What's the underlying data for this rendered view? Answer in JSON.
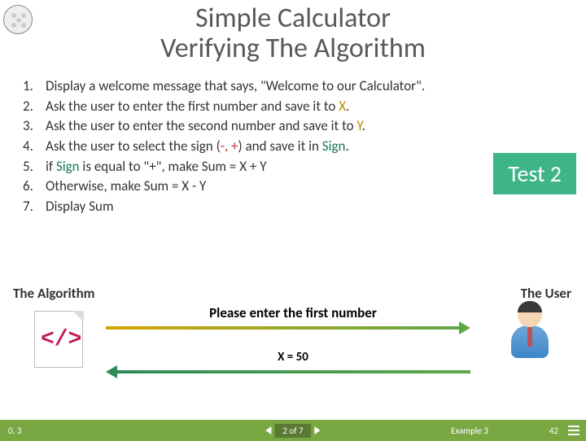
{
  "title": "Simple Calculator",
  "subtitle": "Verifying The Algorithm",
  "steps": [
    {
      "num": "1.",
      "text": "Display a welcome message that says, \"Welcome to our Calculator\"."
    },
    {
      "num": "2.",
      "text": "Ask the user to enter the first number and save it to ",
      "var": "X",
      "varClass": "hl-orange",
      "suffix": "."
    },
    {
      "num": "3.",
      "text": "Ask the user to enter the second number and save it to ",
      "var": "Y",
      "varClass": "hl-orange",
      "suffix": "."
    },
    {
      "num": "4.",
      "text": "Ask the user to select the sign (",
      "mid": "-, +",
      "midClass": "hl-red",
      "text2": ") and save it in ",
      "var": "Sign",
      "varClass": "hl-green",
      "suffix": "."
    },
    {
      "num": "5.",
      "text": "if ",
      "var": "Sign",
      "varClass": "hl-green",
      "text2": " is equal to \"+\", make Sum = X + Y"
    },
    {
      "num": "6.",
      "text": "Otherwise, make Sum = X - Y"
    },
    {
      "num": "7.",
      "text": "Display Sum"
    }
  ],
  "test_badge": "Test 2",
  "labels": {
    "algorithm": "The Algorithm",
    "user": "The User"
  },
  "dialogue": {
    "prompt": "Please enter the first number",
    "answer": "X = 50"
  },
  "footer": {
    "version": "0. 3",
    "progress": "2 of 7",
    "example": "Example 3",
    "page": "42"
  }
}
